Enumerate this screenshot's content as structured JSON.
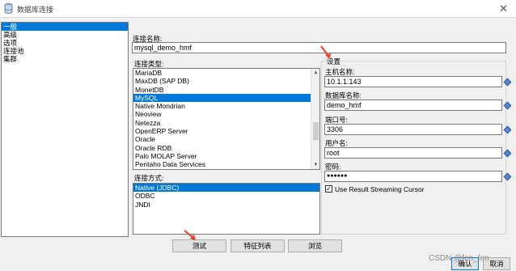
{
  "window": {
    "title": "数据库连接"
  },
  "nav": {
    "items": [
      {
        "label": "一般",
        "selected": true
      },
      {
        "label": "高级",
        "selected": false
      },
      {
        "label": "选项",
        "selected": false
      },
      {
        "label": "连接池",
        "selected": false
      },
      {
        "label": "集群",
        "selected": false
      }
    ]
  },
  "connection_name": {
    "label": "连接名称:",
    "value": "mysql_demo_hmf"
  },
  "connection_type": {
    "label": "连接类型:",
    "items": [
      {
        "label": "MariaDB",
        "selected": false
      },
      {
        "label": "MaxDB (SAP DB)",
        "selected": false
      },
      {
        "label": "MonetDB",
        "selected": false
      },
      {
        "label": "MySQL",
        "selected": true
      },
      {
        "label": "Native Mondrian",
        "selected": false
      },
      {
        "label": "Neoview",
        "selected": false
      },
      {
        "label": "Netezza",
        "selected": false
      },
      {
        "label": "OpenERP Server",
        "selected": false
      },
      {
        "label": "Oracle",
        "selected": false
      },
      {
        "label": "Oracle RDB",
        "selected": false
      },
      {
        "label": "Palo MOLAP Server",
        "selected": false
      },
      {
        "label": "Pentaho Data Services",
        "selected": false
      }
    ]
  },
  "access": {
    "label": "连接方式:",
    "items": [
      {
        "label": "Native (JDBC)",
        "selected": true
      },
      {
        "label": "ODBC",
        "selected": false
      },
      {
        "label": "JNDI",
        "selected": false
      }
    ]
  },
  "settings": {
    "label": "设置",
    "host": {
      "label": "主机名称:",
      "value": "10.1.1.143"
    },
    "database": {
      "label": "数据库名称:",
      "value": "demo_hmf"
    },
    "port": {
      "label": "端口号:",
      "value": "3306"
    },
    "username": {
      "label": "用户名:",
      "value": "root"
    },
    "password": {
      "label": "密码:",
      "value": "●●●●●●"
    },
    "streaming_cursor": {
      "label": "Use Result Streaming Cursor",
      "checked": true,
      "mark": "✓"
    }
  },
  "buttons": {
    "test": "测试",
    "features": "特征列表",
    "explore": "浏览",
    "ok": "确认",
    "cancel": "取消"
  },
  "watermark": "CSDN @fen_fen",
  "colors": {
    "selection": "#0078d7",
    "arrow": "#e8412a"
  }
}
